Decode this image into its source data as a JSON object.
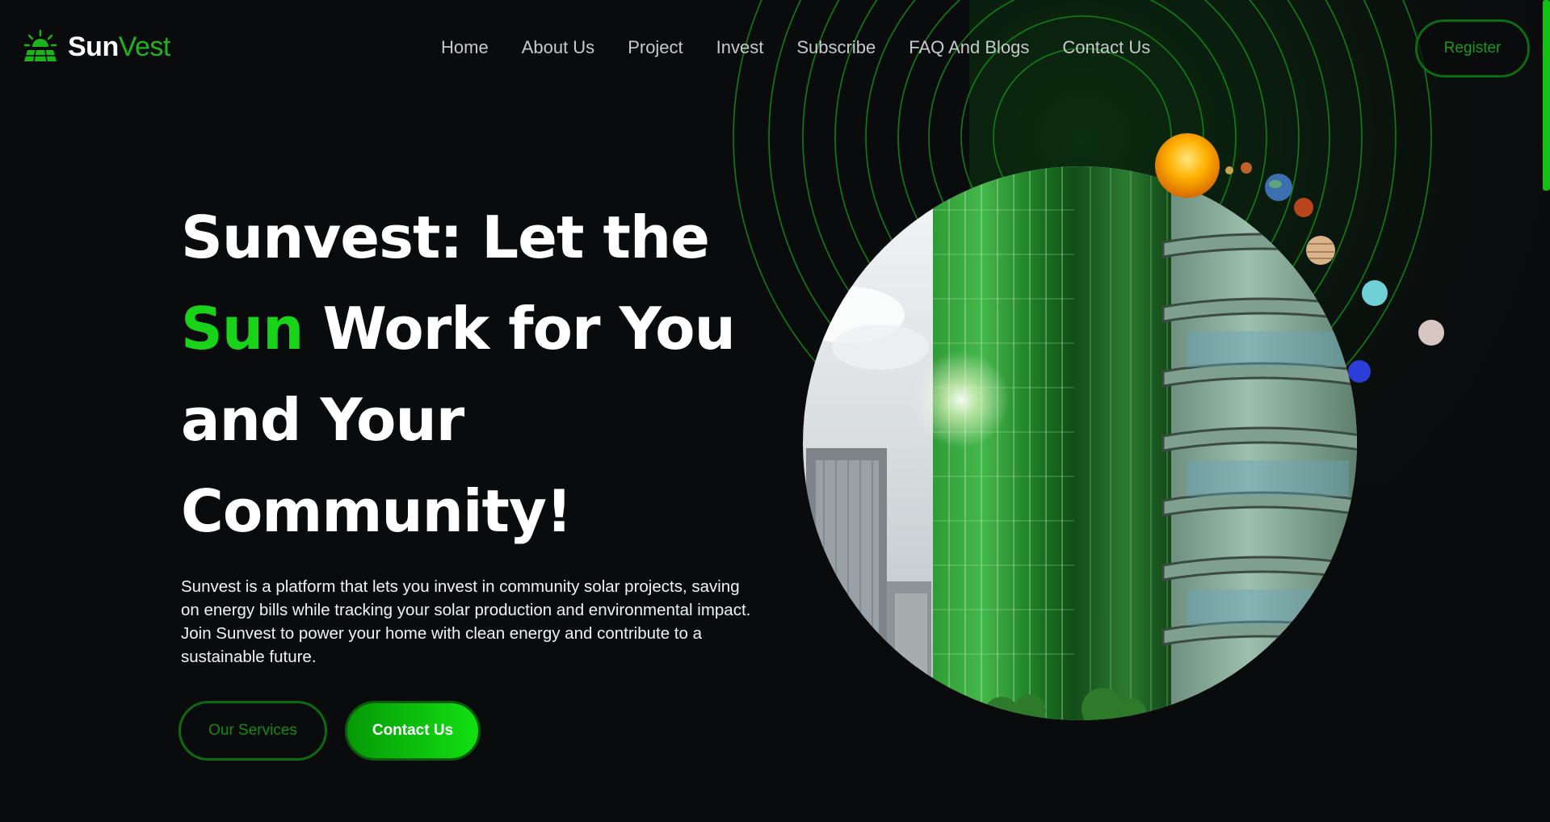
{
  "brand": {
    "name_part1": "Sun",
    "name_part2": "Vest",
    "icon": "solar-panel-sun-icon"
  },
  "nav": {
    "items": [
      {
        "label": "Home"
      },
      {
        "label": "About Us"
      },
      {
        "label": "Project"
      },
      {
        "label": "Invest"
      },
      {
        "label": "Subscribe"
      },
      {
        "label": "FAQ And Blogs"
      },
      {
        "label": "Contact Us"
      }
    ],
    "register_label": "Register"
  },
  "hero": {
    "title_line1": "Sunvest: Let the",
    "title_accent": "Sun",
    "title_line2_rest": " Work for You",
    "title_line3": "and Your",
    "title_line4": "Community!",
    "description": "Sunvest is a platform that lets you invest in community solar projects, saving on energy bills while tracking your solar production and environmental impact. Join Sunvest to power your home with clean energy and contribute to a sustainable future.",
    "primary_cta": "Our Services",
    "secondary_cta": "Contact Us",
    "image": "green-glass-skyscraper-image",
    "decor": "solar-system-orbits-illustration"
  },
  "colors": {
    "background": "#0a0b0d",
    "accent": "#18d318",
    "accent_dark": "#0e6a10",
    "nav_text": "#c8c9cc"
  }
}
